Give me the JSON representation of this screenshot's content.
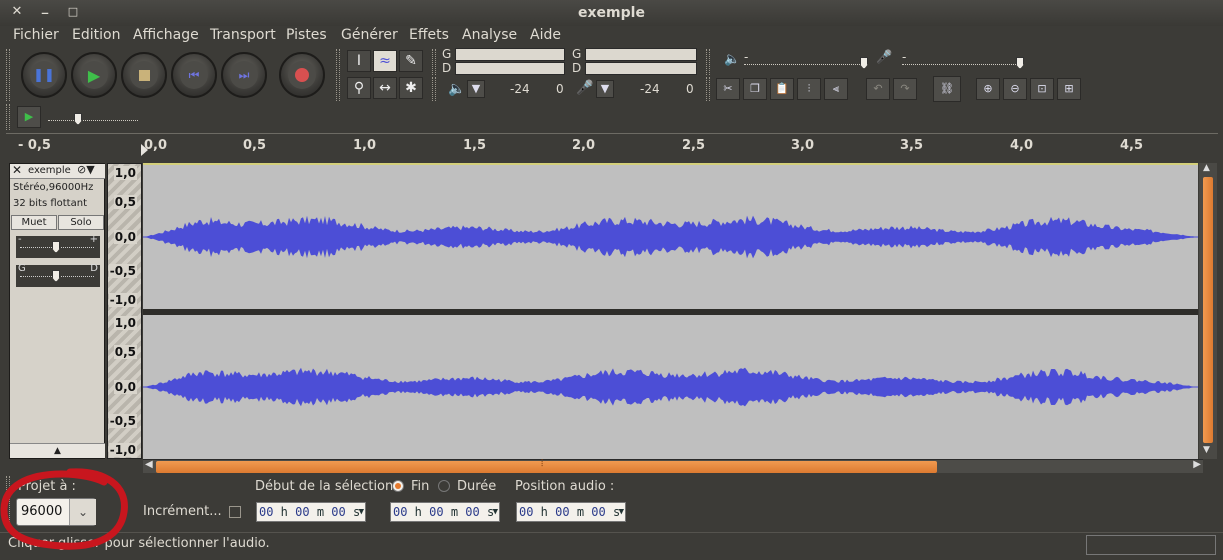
{
  "window": {
    "title": "exemple",
    "close": "✕",
    "minimize": "_",
    "maximize": "□"
  },
  "menu": [
    "Fichier",
    "Edition",
    "Affichage",
    "Transport",
    "Pistes",
    "Générer",
    "Effets",
    "Analyse",
    "Aide"
  ],
  "meters": {
    "left_label": "G",
    "right_label": "D",
    "play_db": "-24",
    "play_zero": "0",
    "rec_db": "-24",
    "rec_zero": "0"
  },
  "ruler": [
    "- 0,5",
    "0,0",
    "0,5",
    "1,0",
    "1,5",
    "2,0",
    "2,5",
    "3,0",
    "3,5",
    "4,0",
    "4,5"
  ],
  "track": {
    "name": "exemple",
    "format": "Stéréo,96000Hz",
    "depth": "32 bits flottant",
    "mute": "Muet",
    "solo": "Solo",
    "gain_minus": "-",
    "gain_plus": "+",
    "pan_left": "G",
    "pan_right": "D",
    "collapse": "▲"
  },
  "vscale": [
    "1,0",
    "0,5",
    "0,0",
    "-0,5",
    "-1,0"
  ],
  "wave_color": "#4c4ed6",
  "selection": {
    "project_label": "Projet à :",
    "rate_value": "96000",
    "snap_label": "Incrément...",
    "start_label": "Début de la sélection",
    "end_label": "Fin",
    "length_label": "Durée",
    "pos_label": "Position audio :",
    "time": {
      "h": "00",
      "m": "00",
      "s": "00"
    }
  },
  "status": "Cliquer-glisser pour sélectionner l'audio.",
  "annotation_color": "#c8161e"
}
